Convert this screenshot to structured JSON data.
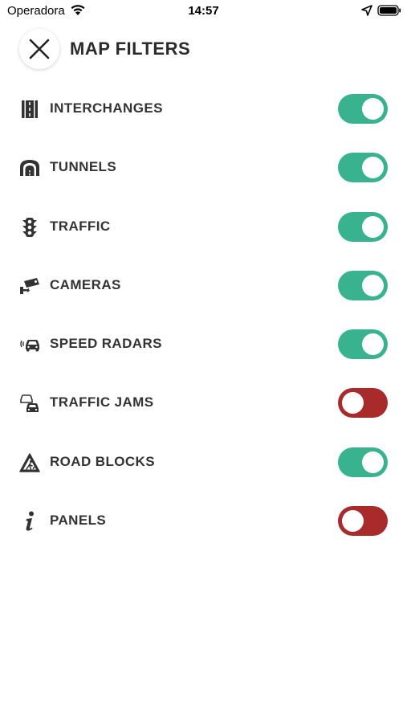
{
  "status_bar": {
    "carrier": "Operadora",
    "time": "14:57"
  },
  "header": {
    "title": "MAP FILTERS",
    "close_icon": "close-icon"
  },
  "colors": {
    "toggle_on": "#39b38f",
    "toggle_off": "#a82a2a",
    "text": "#333333"
  },
  "filters": [
    {
      "label": "INTERCHANGES",
      "icon": "interchange-icon",
      "enabled": true
    },
    {
      "label": "TUNNELS",
      "icon": "tunnel-icon",
      "enabled": true
    },
    {
      "label": "TRAFFIC",
      "icon": "traffic-light-icon",
      "enabled": true
    },
    {
      "label": "CAMERAS",
      "icon": "camera-icon",
      "enabled": true
    },
    {
      "label": "SPEED RADARS",
      "icon": "speed-radar-icon",
      "enabled": true
    },
    {
      "label": "TRAFFIC JAMS",
      "icon": "traffic-jam-icon",
      "enabled": false
    },
    {
      "label": "ROAD BLOCKS",
      "icon": "road-block-icon",
      "enabled": true
    },
    {
      "label": "PANELS",
      "icon": "info-icon",
      "enabled": false
    }
  ]
}
